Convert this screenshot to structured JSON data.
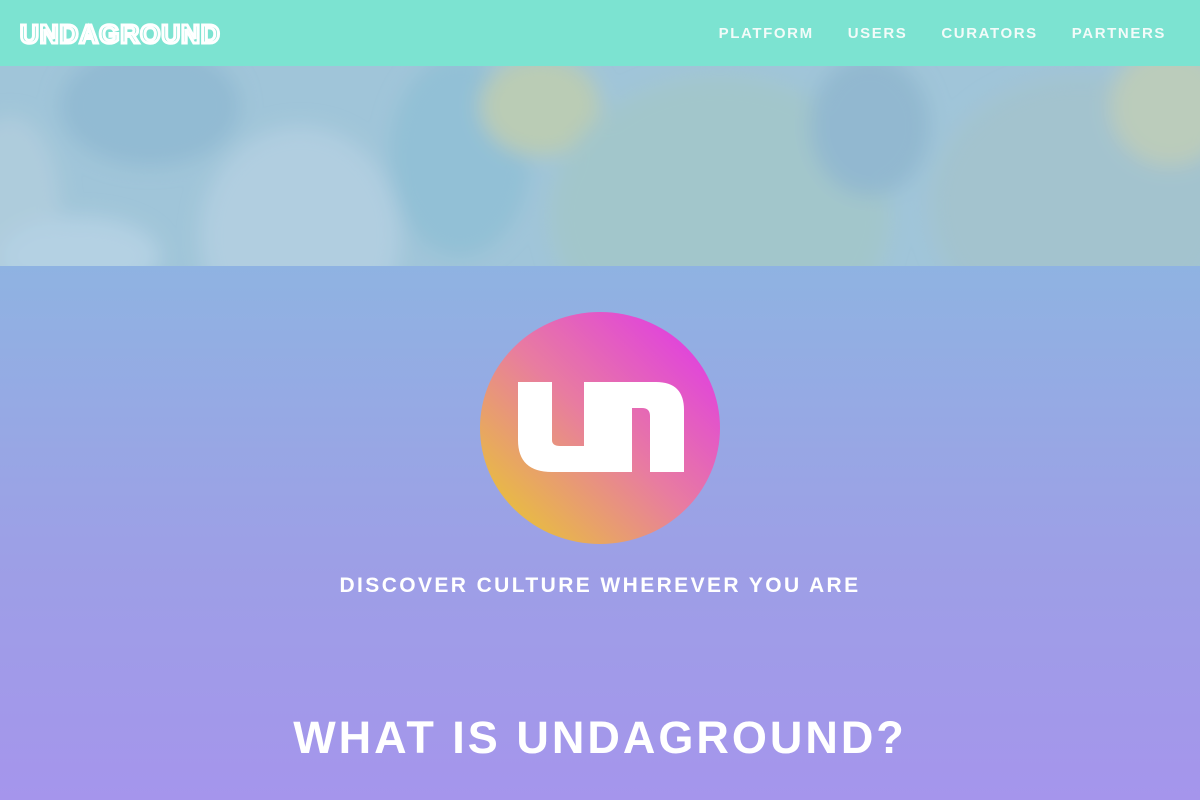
{
  "header": {
    "logo_text": "UNDAGROUND",
    "nav": [
      {
        "label": "PLATFORM"
      },
      {
        "label": "USERS"
      },
      {
        "label": "CURATORS"
      },
      {
        "label": "PARTNERS"
      }
    ]
  },
  "brand_mark": {
    "letters": "un",
    "gradient_colors": [
      "#e8c03c",
      "#e87ca0",
      "#e040e0"
    ]
  },
  "tagline": "DISCOVER CULTURE WHEREVER YOU ARE",
  "section_heading": "WHAT IS UNDAGROUND?",
  "colors": {
    "header_bg": "#7ce3d1",
    "page_top": "#8fb3e2",
    "page_bottom": "#a595ec"
  }
}
